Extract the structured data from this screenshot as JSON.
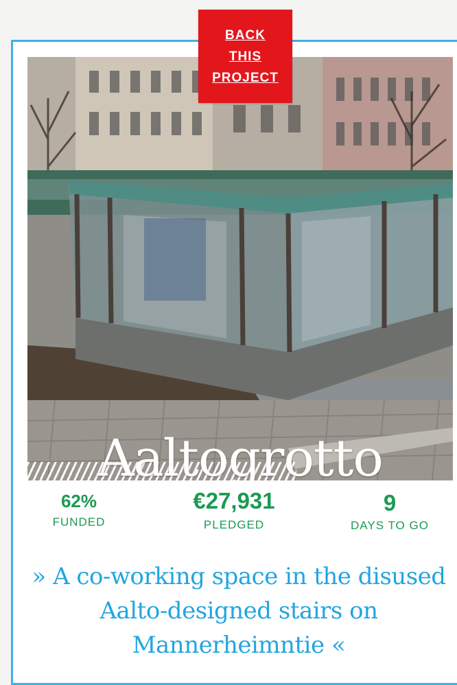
{
  "cta": {
    "line1": "BACK",
    "line2": "THIS",
    "line3": "PROJECT"
  },
  "project": {
    "title": "Aaltogrotto",
    "tagline": "» A co-working space in the disused Aalto-designed stairs on Mannerheimntie «"
  },
  "stats": {
    "funded": {
      "value": "62%",
      "label": "FUNDED"
    },
    "pledged": {
      "value": "€27,931",
      "label": "PLEDGED"
    },
    "days": {
      "value": "9",
      "label": "DAYS TO GO"
    }
  },
  "colors": {
    "accent_red": "#e3161c",
    "frame_blue": "#3fb0e8",
    "stat_green": "#1c9a52",
    "tagline_blue": "#22a5e0"
  }
}
